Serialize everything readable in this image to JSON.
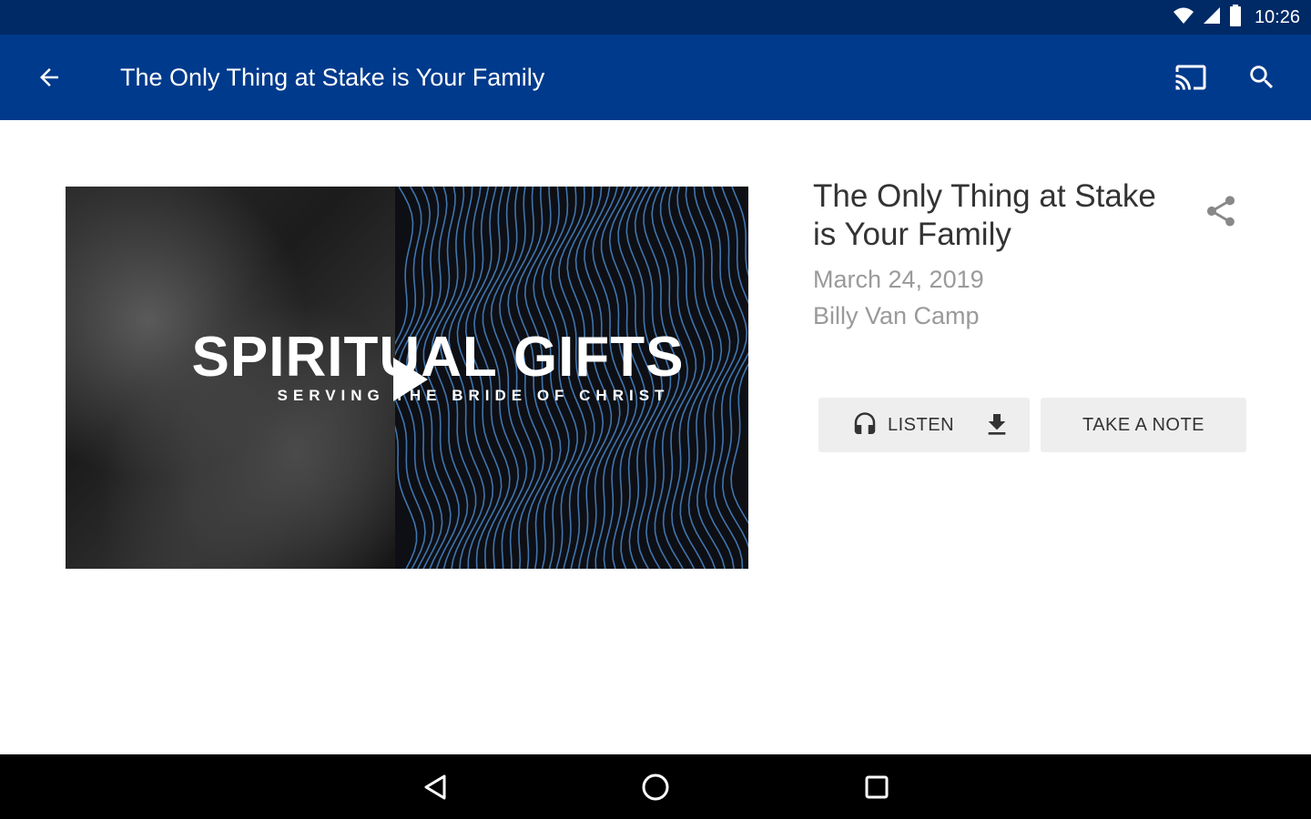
{
  "status_bar": {
    "time": "10:26",
    "icons": [
      "wifi-icon",
      "signal-icon",
      "battery-icon"
    ]
  },
  "app_bar": {
    "title": "The Only Thing at Stake is Your Family",
    "icons": [
      "arrow-left-icon",
      "cast-icon",
      "search-icon"
    ],
    "color": "#003a8c",
    "status_color": "#002a66"
  },
  "media": {
    "title": "SPIRITUAL GIFTS",
    "subtitle": "SERVING THE BRIDE OF CHRIST",
    "icon": "play-icon",
    "line_color": "#4a86c8"
  },
  "sermon": {
    "title": "The Only Thing at Stake is Your Family",
    "date": "March 24, 2019",
    "speaker": "Billy Van Camp",
    "share_icon": "share-icon"
  },
  "actions": {
    "listen_label": "LISTEN",
    "listen_icon": "headphones-icon",
    "download_icon": "download-icon",
    "note_label": "TAKE A NOTE"
  },
  "nav_bar": {
    "icons": [
      "nav-back-icon",
      "nav-home-icon",
      "nav-recents-icon"
    ]
  }
}
